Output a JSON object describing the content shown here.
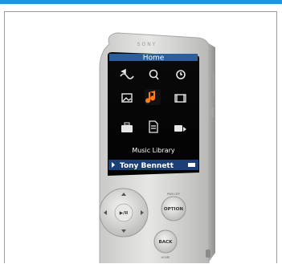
{
  "device": {
    "brand": "SONY",
    "screen": {
      "title": "Home",
      "selected_label": "Music Library",
      "status_text": "Tony Bennett"
    },
    "buttons": {
      "option": "OPTION",
      "back": "BACK",
      "play_pause": "▶/II",
      "option_caption": "PWR OFF",
      "back_caption": "HOME"
    },
    "icons": [
      "shuffle-icon",
      "search-icon",
      "clock-icon",
      "photo-icon",
      "music-note-icon",
      "video-icon",
      "briefcase-icon",
      "document-icon",
      "podcast-icon"
    ],
    "colors": {
      "accent_bar": "#1e96d6",
      "highlight": "#ff7a18",
      "body": "#d4d4d2"
    }
  }
}
